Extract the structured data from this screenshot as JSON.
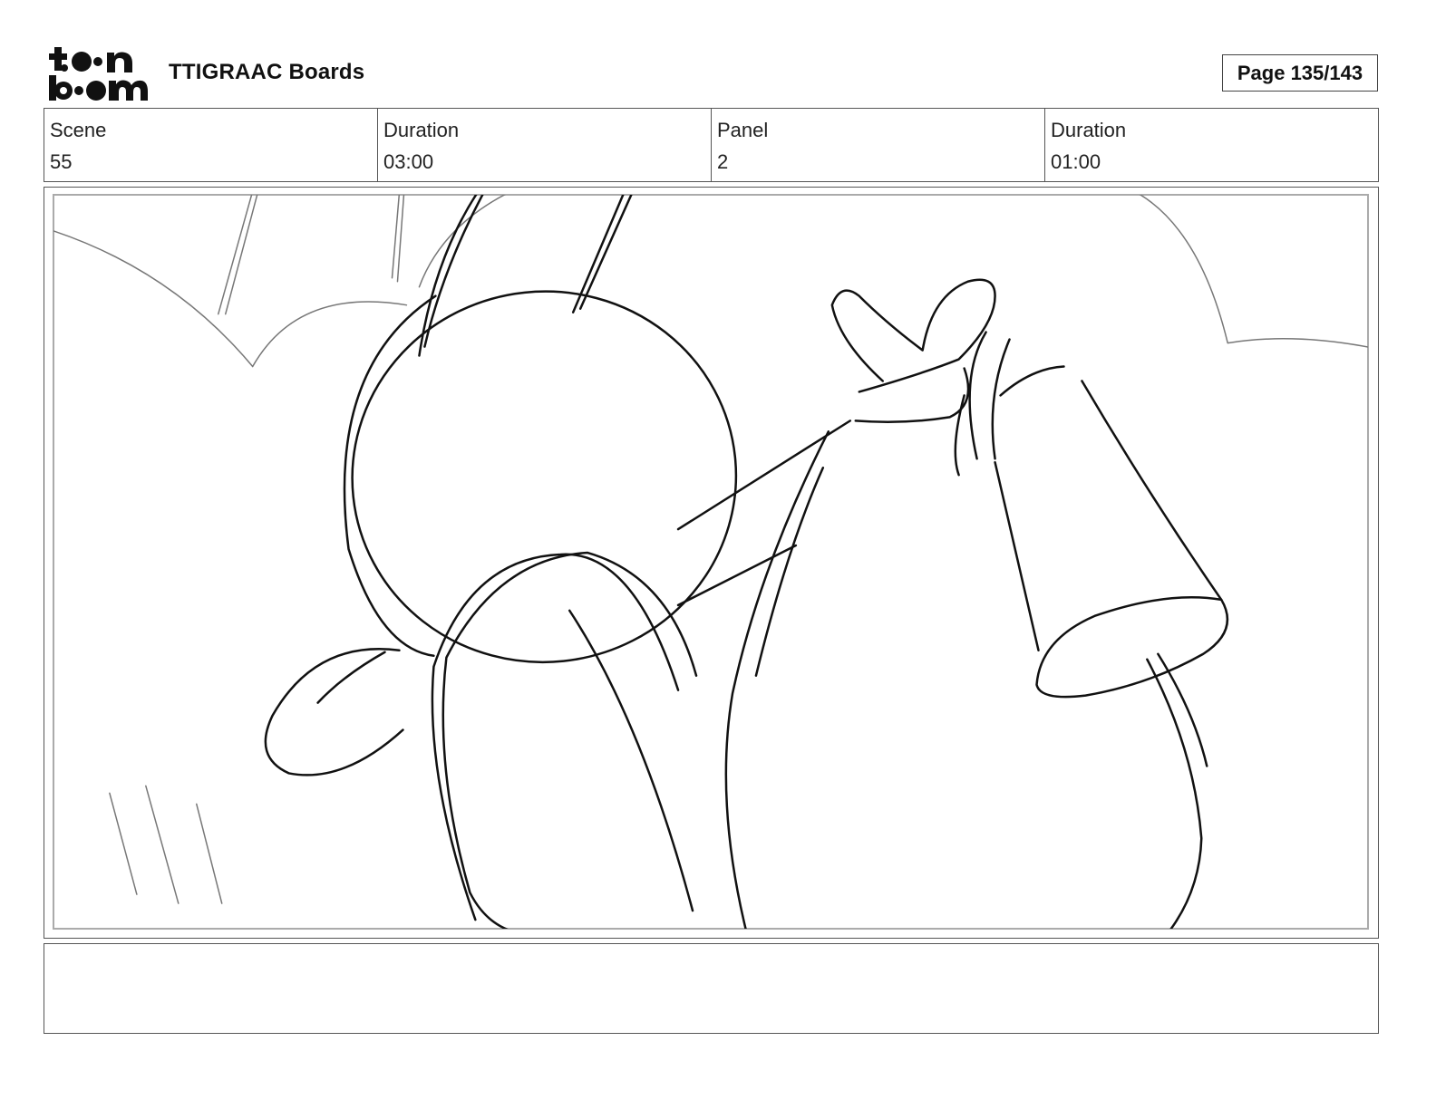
{
  "header": {
    "logo_text": "toon boom",
    "project_title": "TTIGRAAC Boards",
    "page_counter": "Page 135/143"
  },
  "info": {
    "scene_label": "Scene",
    "scene_value": "55",
    "scene_duration_label": "Duration",
    "scene_duration_value": "03:00",
    "panel_label": "Panel",
    "panel_value": "2",
    "panel_duration_label": "Duration",
    "panel_duration_value": "01:00"
  },
  "notes": {
    "text": ""
  }
}
